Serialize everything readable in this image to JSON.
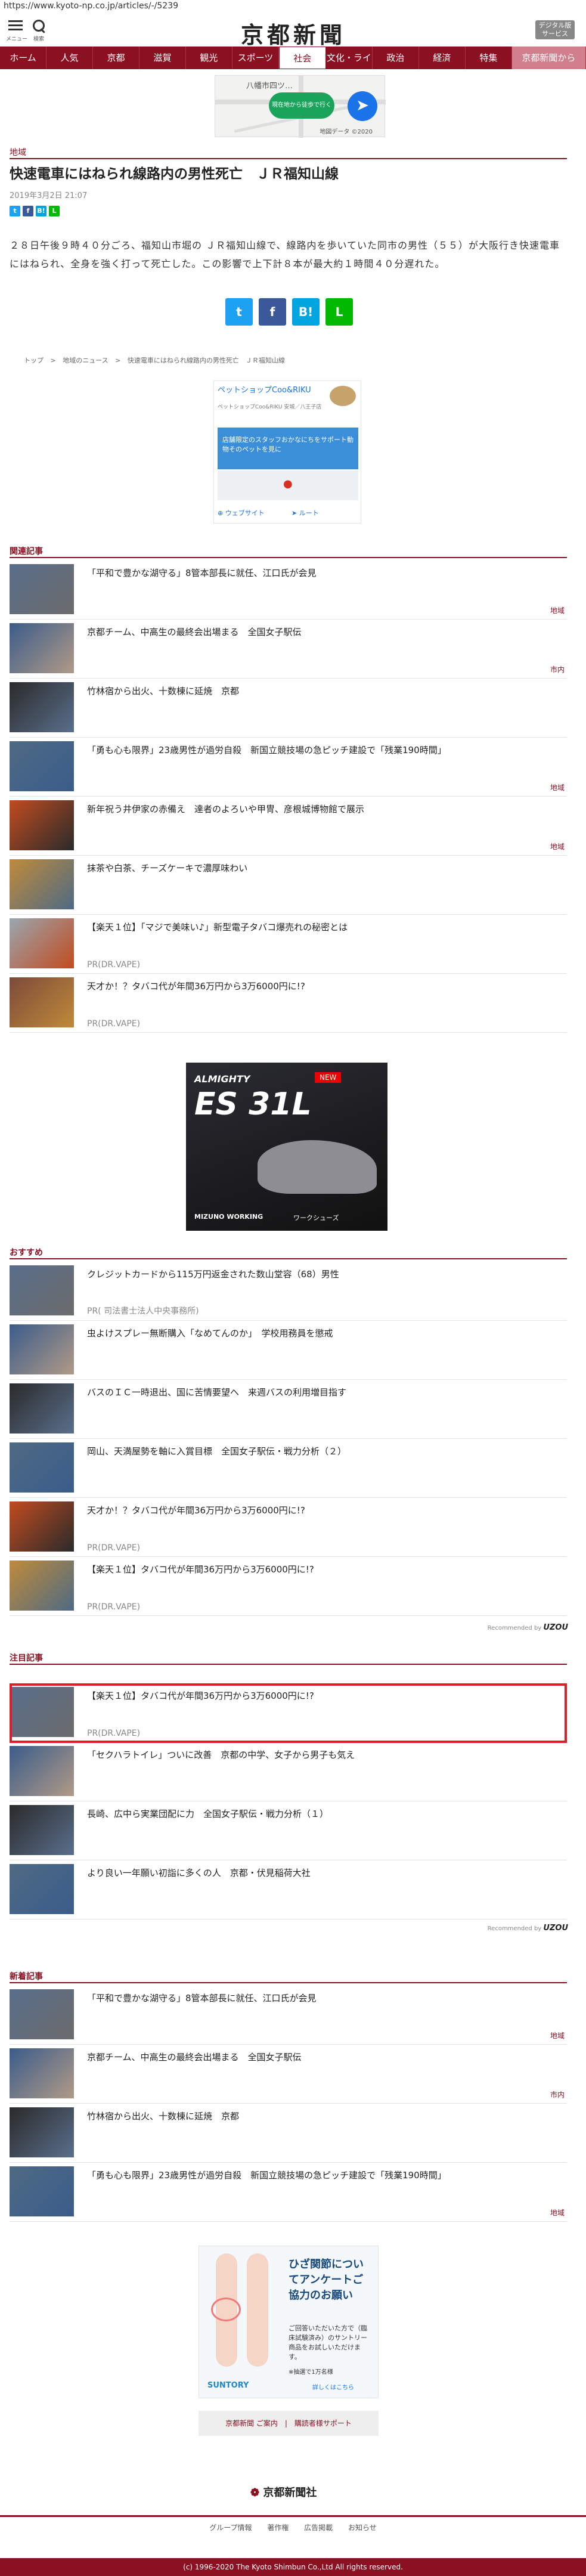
{
  "url": "https://www.kyoto-np.co.jp/articles/-/5239",
  "header": {
    "menu_label": "メニュー",
    "search_label": "検索",
    "logo": "京都新聞",
    "digital_btn": "デジタル版 サービス"
  },
  "nav": [
    "ホーム",
    "人気",
    "京都",
    "滋賀",
    "観光",
    "スポーツ",
    "社会",
    "文化・ライフ",
    "政治",
    "経済",
    "特集",
    "京都新聞から"
  ],
  "nav_active": "社会",
  "map_ad": {
    "place": "八幡市四ツ…",
    "button": "現在地から徒歩で行く",
    "credit": "地図データ ©2020"
  },
  "article": {
    "category": "地域",
    "title": "快速電車にはねられ線路内の男性死亡　ＪＲ福知山線",
    "date": "2019年3月2日 21:07",
    "body": "２８日午後９時４０分ごろ、福知山市堀の ＪＲ福知山線で、線路内を歩いていた同市の男性（５５）が大阪行き快速電車にはねられ、全身を強く打って死亡した。この影響で上下計８本が最大約１時間４０分遅れた。"
  },
  "share_small": [
    "t",
    "f",
    "B!",
    "L"
  ],
  "share_big": [
    "t",
    "f",
    "B!",
    "L"
  ],
  "breadcrumb": [
    "トップ",
    ">",
    "地域のニュース",
    ">",
    "快速電車にはねられ線路内の男性死亡　ＪＲ福知山線"
  ],
  "shop_ad": {
    "title": "ペットショップCoo&RIKU",
    "sub": "ペットショップCoo&RIKU 安城／八王子店",
    "banner": "店舗限定のスタッフおかなにちをサポート動物そのペットを見に",
    "web": "ウェブサイト",
    "route": "ルート"
  },
  "related": {
    "heading": "関連記事",
    "items": [
      {
        "text": "「平和で豊かな湖守る」8管本部長に就任、江口氏が会見",
        "label": "地域",
        "pr": ""
      },
      {
        "text": "京都チーム、中高生の最終会出場まる　全国女子駅伝",
        "label": "市内",
        "pr": ""
      },
      {
        "text": "竹林宿から出火、十数棟に延焼　京都",
        "label": "",
        "pr": ""
      },
      {
        "text": "「勇も心も限界」23歳男性が過労自殺　新国立競技場の急ピッチ建設で「残業190時間」",
        "label": "地域",
        "pr": ""
      },
      {
        "text": "新年祝う井伊家の赤備え　達者のよろいや甲冑、彦根城博物館で展示",
        "label": "地域",
        "pr": ""
      },
      {
        "text": "抹茶や白茶、チーズケーキで濃厚味わい",
        "label": "",
        "pr": ""
      },
      {
        "text": "【楽天１位】「マジで美味い♪」新型電子タバコ爆売れの秘密とは",
        "label": "",
        "pr": "PR(DR.VAPE)"
      },
      {
        "text": "天才か！？タバコ代が年間36万円から3万6000円に!?",
        "label": "",
        "pr": "PR(DR.VAPE)"
      }
    ]
  },
  "shoe_ad": {
    "brand": "ALMIGHTY",
    "model": "ES 31L",
    "badge": "NEW",
    "maker": "MIZUNO WORKING",
    "tag": "ワークシューズ"
  },
  "recommend": {
    "heading": "おすすめ",
    "items": [
      {
        "text": "クレジットカードから115万円返金された数山堂容（68）男性",
        "pr": "PR(  司法書士法人中央事務所)"
      },
      {
        "text": "虫よけスプレー無断購入「なめてんのか」　学校用務員を懲戒",
        "pr": ""
      },
      {
        "text": "バスのＩＣ一時退出、国に苦情要望へ　来週バスの利用増目指す",
        "pr": ""
      },
      {
        "text": "岡山、天満屋勢を軸に入賞目標　全国女子駅伝・戦力分析（２）",
        "pr": ""
      },
      {
        "text": "天才か！？タバコ代が年間36万円から3万6000円に!?",
        "pr": "PR(DR.VAPE)"
      },
      {
        "text": "【楽天１位】タバコ代が年間36万円から3万6000円に!?",
        "pr": "PR(DR.VAPE)"
      }
    ],
    "credit_prefix": "Recommended by",
    "credit_brand": "UZOU"
  },
  "featured": {
    "heading": "注目記事",
    "items": [
      {
        "text": "【楽天１位】タバコ代が年間36万円から3万6000円に!?",
        "pr": "PR(DR.VAPE)"
      },
      {
        "text": "「セクハラトイレ」ついに改善　京都の中学、女子から男子も気え",
        "pr": ""
      },
      {
        "text": "長崎、広中ら実業団配に力　全国女子駅伝・戦力分析（１）",
        "pr": ""
      },
      {
        "text": "より良い一年願い初詣に多くの人　京都・伏見稲荷大社",
        "pr": ""
      }
    ],
    "credit_prefix": "Recommended by",
    "credit_brand": "UZOU"
  },
  "latest": {
    "heading": "新着記事",
    "items": [
      {
        "text": "「平和で豊かな湖守る」8管本部長に就任、江口氏が会見",
        "label": "地域"
      },
      {
        "text": "京都チーム、中高生の最終会出場まる　全国女子駅伝",
        "label": "市内"
      },
      {
        "text": "竹林宿から出火、十数棟に延焼　京都",
        "label": ""
      },
      {
        "text": "「勇も心も限界」23歳男性が過労自殺　新国立競技場の急ピッチ建設で「残業190時間」",
        "label": "地域"
      }
    ]
  },
  "knee_ad": {
    "title": "ひざ関節についてアンケートご協力のお願い",
    "body": "ご回答いただいた方で（臨床試験済み）のサントリー商品をお試しいただけます。",
    "note": "※抽選で1万名様",
    "brand": "SUNTORY",
    "more": "詳しくはこちら"
  },
  "footer_links": "京都新聞 ご案内　|　購読者様サポート",
  "footer_logo": "京都新聞社",
  "footer_nav": "グループ情報 著作権 広告掲載 お知らせ",
  "copyright": "(c) 1996-2020 The Kyoto Shimbun Co.,Ltd All rights reserved."
}
